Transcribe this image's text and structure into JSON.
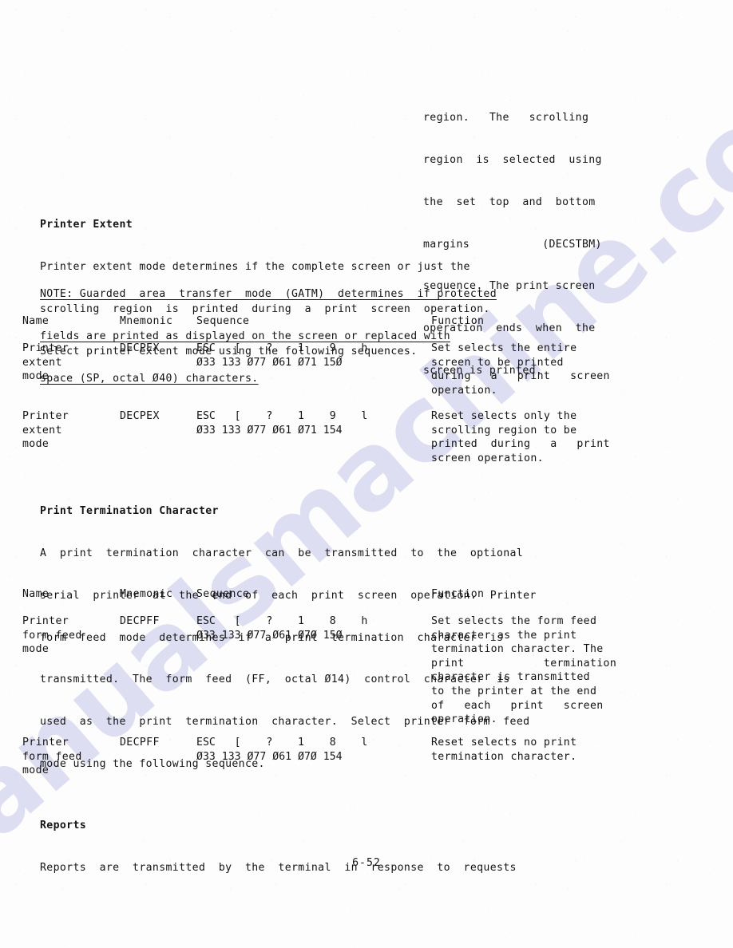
{
  "page": {
    "number": "6-52",
    "watermark": "manualsmachine.com"
  },
  "continuation": {
    "lines": [
      "region.   The   scrolling",
      "region  is  selected  using",
      "the  set  top  and  bottom",
      "margins           (DECSTBM)",
      "sequence. The print screen",
      "operation  ends  when  the",
      "screen is printed."
    ]
  },
  "printer_extent": {
    "heading": "Printer Extent",
    "body": [
      "Printer extent mode determines if the complete screen or just the",
      "scrolling  region  is  printed  during  a  print  screen  operation.",
      "Select printer extent mode using the following sequences."
    ]
  },
  "note": {
    "lines": [
      "NOTE: Guarded  area  transfer  mode  (GATM)  determines  if protected",
      "fields are printed as displayed on the screen or replaced with",
      "space (SP, octal Ø40) characters."
    ]
  },
  "table1": {
    "headers": {
      "name": "Name",
      "mnemonic": "Mnemonic",
      "sequence": "Sequence",
      "function": "Function"
    },
    "rows": [
      {
        "name": "Printer\nextent\nmode",
        "mnemonic": "DECPEX",
        "sequence_chars": "ESC   [    ?    1    9    h",
        "sequence_octal": "Ø33 133 Ø77 Ø61 Ø71 15Ø",
        "function": "Set selects the entire\nscreen to be printed\nduring   a   print   screen\noperation."
      },
      {
        "name": "Printer\nextent\nmode",
        "mnemonic": "DECPEX",
        "sequence_chars": "ESC   [    ?    1    9    l",
        "sequence_octal": "Ø33 133 Ø77 Ø61 Ø71 154",
        "function": "Reset selects only the\nscrolling region to be\nprinted  during   a   print\nscreen operation."
      }
    ]
  },
  "print_termination": {
    "heading": "Print Termination Character",
    "body": [
      "A  print  termination  character  can  be  transmitted  to  the  optional",
      "serial  printer  at  the  end  of  each  print  screen  operation.  Printer",
      "form  feed  mode  determines  if  a  print  termination  character  is",
      "transmitted.  The  form  feed  (FF,  octal Ø14)  control  character  is",
      "used  as  the  print  termination  character.  Select  printer  form  feed",
      "mode using the following sequence."
    ]
  },
  "table2": {
    "headers": {
      "name": "Name",
      "mnemonic": "Mnemonic",
      "sequence": "Sequence",
      "function": "Function"
    },
    "rows": [
      {
        "name": "Printer\nform feed\nmode",
        "mnemonic": "DECPFF",
        "sequence_chars": "ESC   [    ?    1    8    h",
        "sequence_octal": "Ø33 133 Ø77 Ø61 Ø7Ø 15Ø",
        "function": "Set selects the form feed\ncharacter as the print\ntermination character. The\nprint            termination\ncharacter is transmitted\nto the printer at the end\nof   each   print   screen\noperation."
      },
      {
        "name": "Printer\nform feed\nmode",
        "mnemonic": "DECPFF",
        "sequence_chars": "ESC   [    ?    1    8    l",
        "sequence_octal": "Ø33 133 Ø77 Ø61 Ø7Ø 154",
        "function": "Reset selects no print\ntermination character."
      }
    ]
  },
  "reports": {
    "heading": "Reports",
    "body": [
      "Reports  are  transmitted  by  the  terminal  in  response  to  requests"
    ]
  }
}
